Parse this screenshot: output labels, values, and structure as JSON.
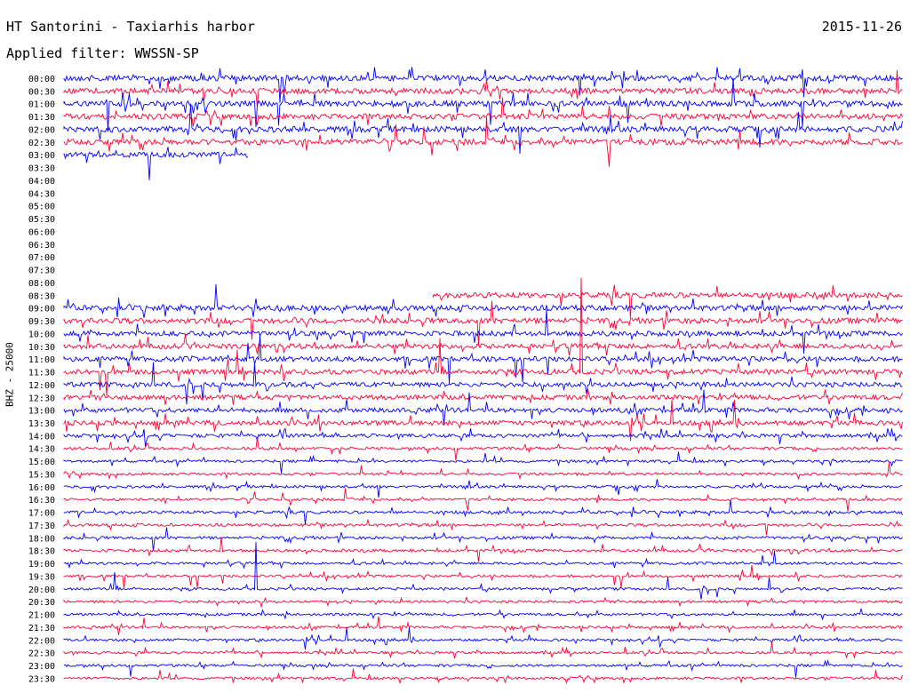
{
  "header": {
    "station": "HT Santorini - Taxiarhis harbor",
    "date": "2015-11-26",
    "filter": "Applied filter: WWSSN-SP"
  },
  "chart_data": {
    "type": "line",
    "title": "HT Santorini - Taxiarhis harbor",
    "ylabel": "BHZ - 25000",
    "colors": [
      "#0000ff",
      "#ff0033"
    ],
    "grid": false,
    "time_labels": [
      "00:00",
      "00:30",
      "01:00",
      "01:30",
      "02:00",
      "02:30",
      "03:00",
      "03:30",
      "04:00",
      "04:30",
      "05:00",
      "05:30",
      "06:00",
      "06:30",
      "07:00",
      "07:30",
      "08:00",
      "08:30",
      "09:00",
      "09:30",
      "10:00",
      "10:30",
      "11:00",
      "11:30",
      "12:00",
      "12:30",
      "13:00",
      "13:30",
      "14:00",
      "14:30",
      "15:00",
      "15:30",
      "16:00",
      "16:30",
      "17:00",
      "17:30",
      "18:00",
      "18:30",
      "19:00",
      "19:30",
      "20:00",
      "20:30",
      "21:00",
      "21:30",
      "22:00",
      "22:30",
      "23:00",
      "23:30"
    ],
    "rows": [
      {
        "time": "00:00",
        "start": 0,
        "end": 1,
        "level": 0.9
      },
      {
        "time": "00:30",
        "start": 0,
        "end": 1,
        "level": 0.9
      },
      {
        "time": "01:00",
        "start": 0,
        "end": 1,
        "level": 0.9
      },
      {
        "time": "01:30",
        "start": 0,
        "end": 1,
        "level": 0.9
      },
      {
        "time": "02:00",
        "start": 0,
        "end": 1,
        "level": 0.9
      },
      {
        "time": "02:30",
        "start": 0,
        "end": 1,
        "level": 0.9
      },
      {
        "time": "03:00",
        "start": 0,
        "end": 0.22,
        "level": 0.85
      },
      {
        "time": "08:30",
        "start": 0.44,
        "end": 1,
        "level": 0.85
      },
      {
        "time": "09:00",
        "start": 0,
        "end": 1,
        "level": 0.85
      },
      {
        "time": "09:30",
        "start": 0,
        "end": 1,
        "level": 0.85
      },
      {
        "time": "10:00",
        "start": 0,
        "end": 1,
        "level": 0.8
      },
      {
        "time": "10:30",
        "start": 0,
        "end": 1,
        "level": 0.8
      },
      {
        "time": "11:00",
        "start": 0,
        "end": 1,
        "level": 0.8
      },
      {
        "time": "11:30",
        "start": 0,
        "end": 1,
        "level": 0.8
      },
      {
        "time": "12:00",
        "start": 0,
        "end": 1,
        "level": 0.75
      },
      {
        "time": "12:30",
        "start": 0,
        "end": 1,
        "level": 0.75
      },
      {
        "time": "13:00",
        "start": 0,
        "end": 1,
        "level": 0.75
      },
      {
        "time": "13:30",
        "start": 0,
        "end": 1,
        "level": 0.75
      },
      {
        "time": "14:00",
        "start": 0,
        "end": 1,
        "level": 0.6
      },
      {
        "time": "14:30",
        "start": 0,
        "end": 1,
        "level": 0.45
      },
      {
        "time": "15:00",
        "start": 0,
        "end": 1,
        "level": 0.4
      },
      {
        "time": "15:30",
        "start": 0,
        "end": 1,
        "level": 0.4
      },
      {
        "time": "16:00",
        "start": 0,
        "end": 1,
        "level": 0.4
      },
      {
        "time": "16:30",
        "start": 0,
        "end": 1,
        "level": 0.4
      },
      {
        "time": "17:00",
        "start": 0,
        "end": 1,
        "level": 0.45
      },
      {
        "time": "17:30",
        "start": 0,
        "end": 1,
        "level": 0.45
      },
      {
        "time": "18:00",
        "start": 0,
        "end": 1,
        "level": 0.45
      },
      {
        "time": "18:30",
        "start": 0,
        "end": 1,
        "level": 0.45
      },
      {
        "time": "19:00",
        "start": 0,
        "end": 1,
        "level": 0.4
      },
      {
        "time": "19:30",
        "start": 0,
        "end": 1,
        "level": 0.4
      },
      {
        "time": "20:00",
        "start": 0,
        "end": 1,
        "level": 0.4
      },
      {
        "time": "20:30",
        "start": 0,
        "end": 1,
        "level": 0.4
      },
      {
        "time": "21:00",
        "start": 0,
        "end": 1,
        "level": 0.4
      },
      {
        "time": "21:30",
        "start": 0,
        "end": 1,
        "level": 0.4
      },
      {
        "time": "22:00",
        "start": 0,
        "end": 1,
        "level": 0.4
      },
      {
        "time": "22:30",
        "start": 0,
        "end": 1,
        "level": 0.4
      },
      {
        "time": "23:00",
        "start": 0,
        "end": 1,
        "level": 0.4
      },
      {
        "time": "23:30",
        "start": 0,
        "end": 1,
        "level": 0.4
      }
    ]
  }
}
